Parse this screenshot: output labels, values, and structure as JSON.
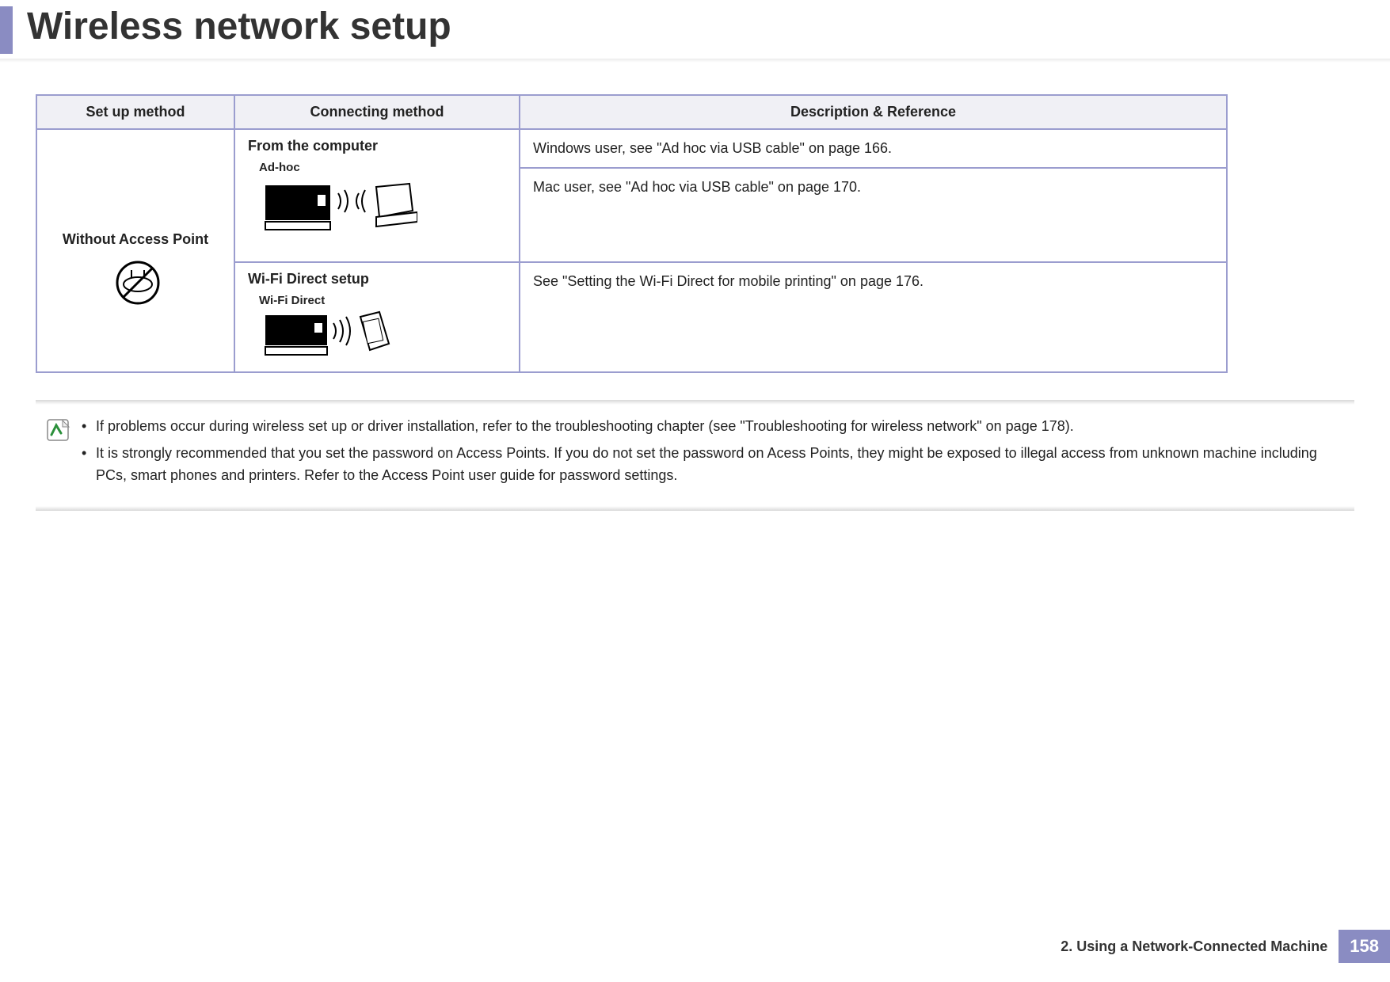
{
  "title": "Wireless network setup",
  "table": {
    "headers": {
      "setup": "Set up method",
      "connecting": "Connecting method",
      "description": "Description & Reference"
    },
    "setup_label": "Without Access Point",
    "row1": {
      "connecting": "From the computer",
      "illus_label": "Ad-hoc",
      "desc1": "Windows user, see \"Ad hoc via USB cable\" on page 166.",
      "desc2": "Mac user, see \"Ad hoc via USB cable\" on page 170."
    },
    "row2": {
      "connecting": "Wi-Fi Direct setup",
      "illus_label": "Wi-Fi Direct",
      "desc": "See \"Setting the Wi-Fi Direct for mobile printing\" on page 176."
    }
  },
  "notes": {
    "item1": "If problems occur during wireless set up or driver installation, refer to the troubleshooting chapter (see \"Troubleshooting for wireless network\" on page 178).",
    "item2": "It is strongly recommended that you set the password on Access Points. If you do not set the password on Acess Points, they might be exposed to illegal access from unknown machine including PCs, smart phones and printers. Refer to the Access Point user guide for password settings."
  },
  "footer": {
    "chapter": "2.  Using a Network-Connected Machine",
    "page": "158"
  }
}
